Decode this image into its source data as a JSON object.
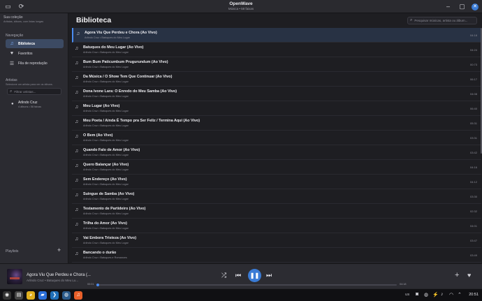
{
  "window": {
    "title": "OpenWave",
    "subtitle": "Música • 58 faixas"
  },
  "sidebar": {
    "collection_title": "Sua coleção",
    "collection_sub": "Artistas, álbuns, com listas longas",
    "nav_title": "Navegação",
    "nav_items": [
      {
        "label": "Biblioteca",
        "icon": "music-note-icon"
      },
      {
        "label": "Favoritos",
        "icon": "heart-icon"
      },
      {
        "label": "Fila de reprodução",
        "icon": "queue-icon"
      }
    ],
    "artists_title": "Artistas",
    "artists_hint": "Selecione um artista para ver os álbuns.",
    "filter_placeholder": "Filtrar artistas...",
    "artist": {
      "name": "Arlindo Cruz",
      "meta": "4 álbuns • 58 faixas"
    },
    "playlists_title": "Playlists"
  },
  "main": {
    "title": "Biblioteca",
    "search_placeholder": "Pesquisar músicas, artista ou álbum...",
    "tracks": [
      {
        "title": "Agora Viu Que Perdeu e Chora (Ao Vivo)",
        "sub": "Arlindo Cruz • Batuques do Meu Lugar",
        "dur": "04:18"
      },
      {
        "title": "Batuques do Meu Lugar (Ao Vivo)",
        "sub": "Arlindo Cruz • Batuques do Meu Lugar",
        "dur": "04:24"
      },
      {
        "title": "Bum Bum Paticumbum Prugurundum (Ao Vivo)",
        "sub": "Arlindo Cruz • Batuques do Meu Lugar",
        "dur": "00:73"
      },
      {
        "title": "Da Música / O Show Tem Que Continuar (Ao Vivo)",
        "sub": "Arlindo Cruz • Batuques do Meu Lugar",
        "dur": "06:17"
      },
      {
        "title": "Dona Ivone Lara: O Enredo do Meu Samba (Ao Vivo)",
        "sub": "Arlindo Cruz • Batuques do Meu Lugar",
        "dur": "04:08"
      },
      {
        "title": "Meu Lugar (Ao Vivo)",
        "sub": "Arlindo Cruz • Batuques do Meu Lugar",
        "dur": "06:40"
      },
      {
        "title": "Meu Poeta / Ainda É Tempo pra Ser Feliz / Termina Aqui (Ao Vivo)",
        "sub": "Arlindo Cruz • Batuques do Meu Lugar",
        "dur": "05:31"
      },
      {
        "title": "O Bem (Ao Vivo)",
        "sub": "Arlindo Cruz • Batuques do Meu Lugar",
        "dur": "03:31"
      },
      {
        "title": "Quando Falo de Amor (Ao Vivo)",
        "sub": "Arlindo Cruz • Batuques do Meu Lugar",
        "dur": "03:42"
      },
      {
        "title": "Quero Balançar (Ao Vivo)",
        "sub": "Arlindo Cruz • Batuques do Meu Lugar",
        "dur": "04:16"
      },
      {
        "title": "Sem Endereço (Ao Vivo)",
        "sub": "Arlindo Cruz • Batuques do Meu Lugar",
        "dur": "04:12"
      },
      {
        "title": "Suingue de Samba (Ao Vivo)",
        "sub": "Arlindo Cruz • Batuques do Meu Lugar",
        "dur": "03:30"
      },
      {
        "title": "Testamento de Partideiro (Ao Vivo)",
        "sub": "Arlindo Cruz • Batuques do Meu Lugar",
        "dur": "02:32"
      },
      {
        "title": "Trilha do Amor (Ao Vivo)",
        "sub": "Arlindo Cruz • Batuques do Meu Lugar",
        "dur": "04:01"
      },
      {
        "title": "Vai Embora Tristeza (Ao Vivo)",
        "sub": "Arlindo Cruz • Batuques do Meu Lugar",
        "dur": "03:47"
      },
      {
        "title": "Bancando o durão",
        "sub": "Arlindo Cruz • Batuques e Romances",
        "dur": "03:49"
      }
    ]
  },
  "player": {
    "title": "Agora Viu Que Perdeu e Chora (...",
    "sub": "Arlindo Cruz • Batuques do Meu Lu...",
    "current": "00:01",
    "total": "04:18",
    "progress": 0.004,
    "shuffle_icon": "shuffle-icon",
    "play_state": "playing"
  },
  "taskbar": {
    "lang": "US",
    "clock": "20:51"
  },
  "colors": {
    "accent": "#3a7bd5",
    "active_row": "#283244"
  }
}
